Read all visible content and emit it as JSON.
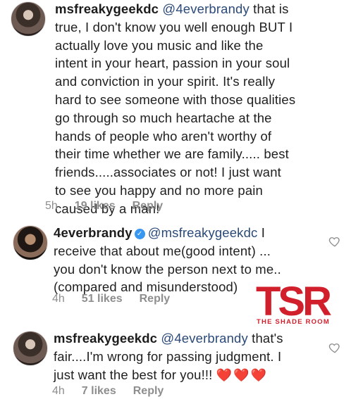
{
  "comments": [
    {
      "username": "msfreakygeekdc",
      "mention": "@4everbrandy",
      "lines": [
        " that is",
        "true, I don't know you well enough BUT I",
        "actually love you music and like the",
        "intent in your heart, passion in your soul",
        "and conviction in your spirit. It's really",
        "hard to see someone with those qualities",
        "go through so much heartache at the",
        "hands of people who aren't worthy of",
        "their time whether we are family..... best",
        "friends.....associates or not! I just want",
        "to see you happy and no more pain",
        "caused by a man!"
      ],
      "time": "5h",
      "likes": "19 likes",
      "reply": "Reply"
    },
    {
      "username": "4everbrandy",
      "verified": true,
      "mention": "@msfreakygeekdc",
      "lines": [
        " I",
        "receive that about me(good intent) ...",
        "you don't know the person next to me..",
        "(compared and misunderstood)"
      ],
      "time": "4h",
      "likes": "51 likes",
      "reply": "Reply"
    },
    {
      "username": "msfreakygeekdc",
      "mention": "@4everbrandy",
      "lines": [
        " that's",
        "fair....I'm wrong for passing judgment. I",
        "just want the best for you!!! "
      ],
      "emoji": "❤️❤️❤️",
      "time": "4h",
      "likes": "7 likes",
      "reply": "Reply"
    }
  ],
  "watermark": {
    "logo": "TSR",
    "subtitle": "THE SHADE ROOM",
    "color": "#d11f2c"
  },
  "icons": {
    "like": "heart-outline-icon",
    "verified": "verified-badge-icon"
  }
}
